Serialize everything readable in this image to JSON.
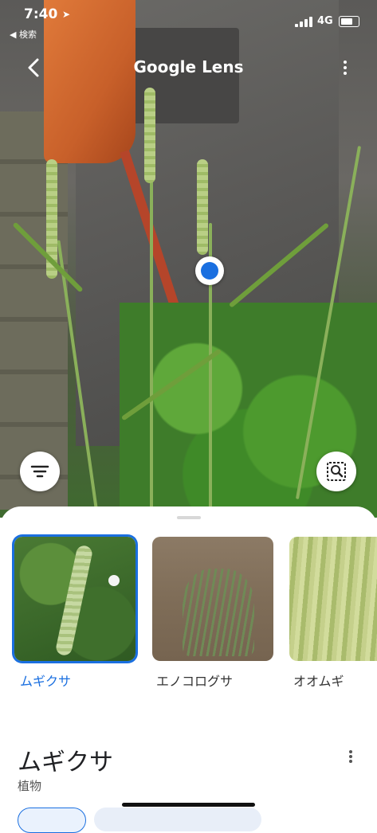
{
  "status_bar": {
    "time": "7:40",
    "back_app": "◀ 検索",
    "network": "4G"
  },
  "header": {
    "title": "Google Lens"
  },
  "results": [
    {
      "label": "ムギクサ",
      "selected": true
    },
    {
      "label": "エノコログサ",
      "selected": false
    },
    {
      "label": "オオムギ",
      "selected": false
    }
  ],
  "detail": {
    "name": "ムギクサ",
    "category": "植物"
  },
  "colors": {
    "accent": "#1a6fe0"
  },
  "icons": {
    "back": "chevron-left-icon",
    "more": "more-vert-icon",
    "filter": "filter-icon",
    "search": "image-search-icon",
    "location": "location-arrow-icon"
  }
}
